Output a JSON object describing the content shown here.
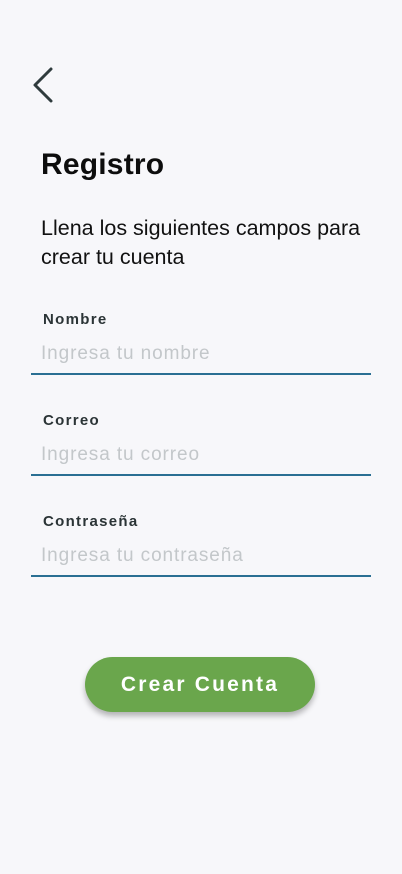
{
  "header": {
    "back_icon": "chevron-left-icon",
    "title": "Registro",
    "subtitle": "Llena los siguientes campos para crear tu cuenta"
  },
  "form": {
    "fields": [
      {
        "label": "Nombre",
        "placeholder": "Ingresa tu nombre",
        "value": ""
      },
      {
        "label": "Correo",
        "placeholder": "Ingresa tu correo",
        "value": ""
      },
      {
        "label": "Contraseña",
        "placeholder": "Ingresa tu contraseña",
        "value": ""
      }
    ],
    "submit_label": "Crear Cuenta"
  },
  "colors": {
    "background": "#f7f7fa",
    "underline": "#2a6f93",
    "button": "#6aa64c",
    "placeholder": "#c3c7ca"
  }
}
